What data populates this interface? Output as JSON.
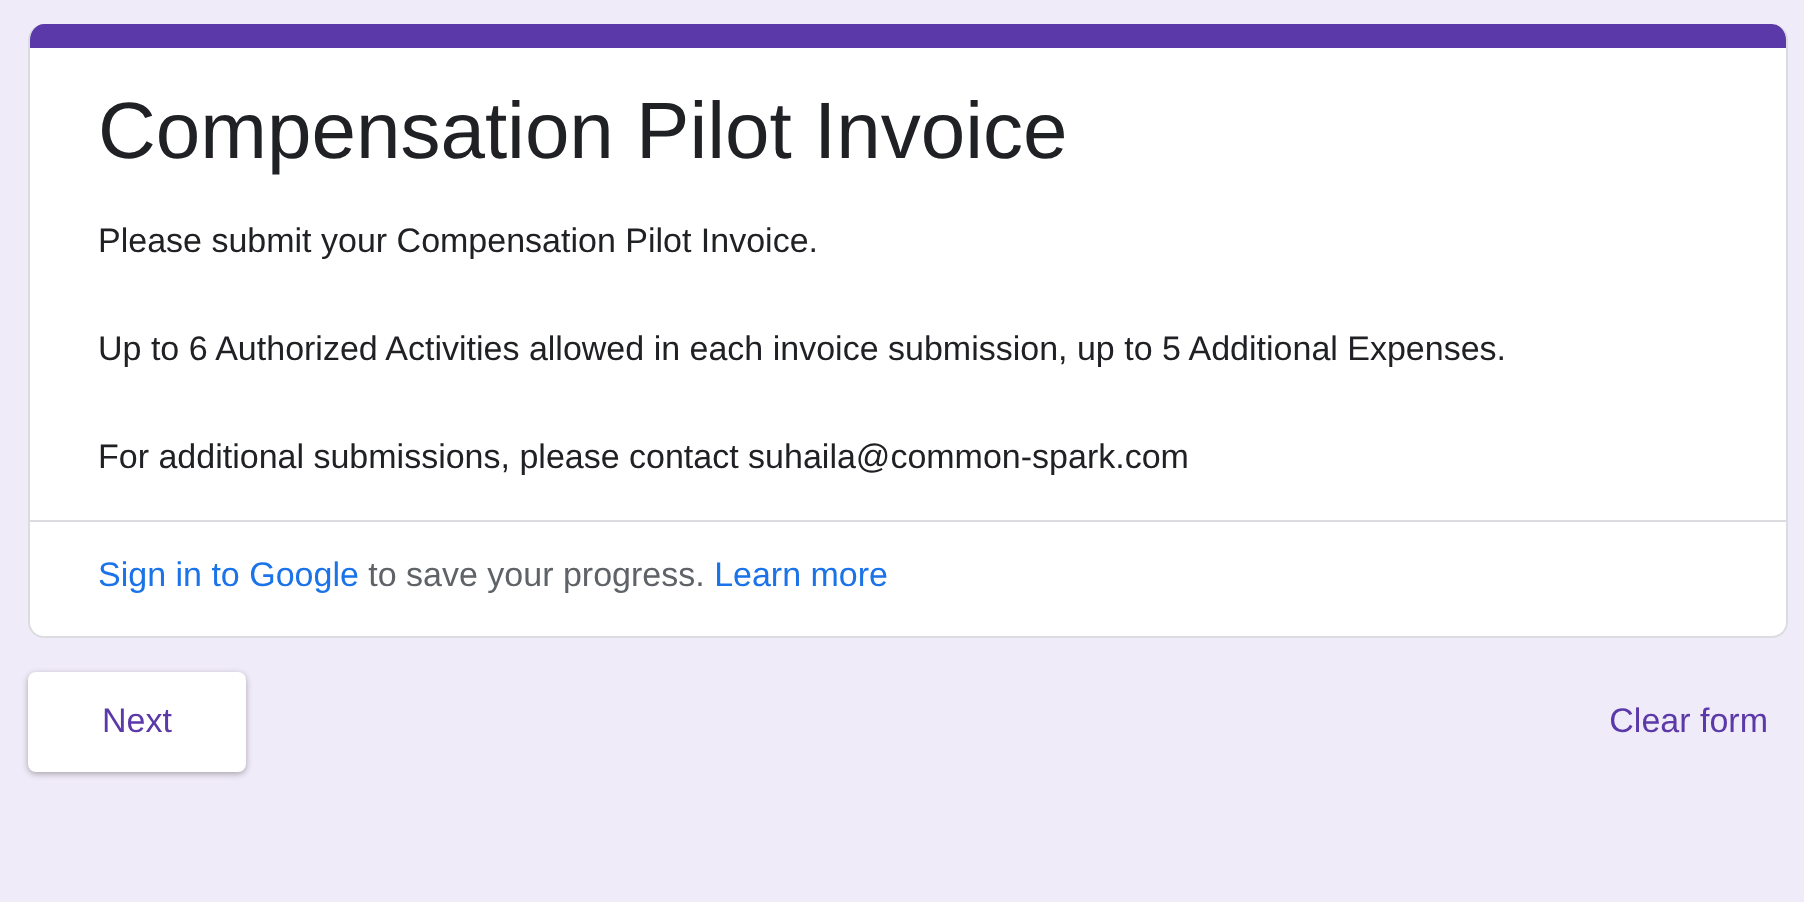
{
  "form": {
    "title": "Compensation Pilot Invoice",
    "description": [
      "Please submit your Compensation Pilot Invoice.",
      "Up to 6 Authorized Activities allowed in each invoice submission, up to 5 Additional Expenses.",
      "For additional submissions, please contact suhaila@common-spark.com"
    ],
    "sign_in": {
      "link": "Sign in to Google",
      "text": "to save your progress.",
      "learn_more": "Learn more"
    }
  },
  "buttons": {
    "next": "Next",
    "clear": "Clear form"
  }
}
